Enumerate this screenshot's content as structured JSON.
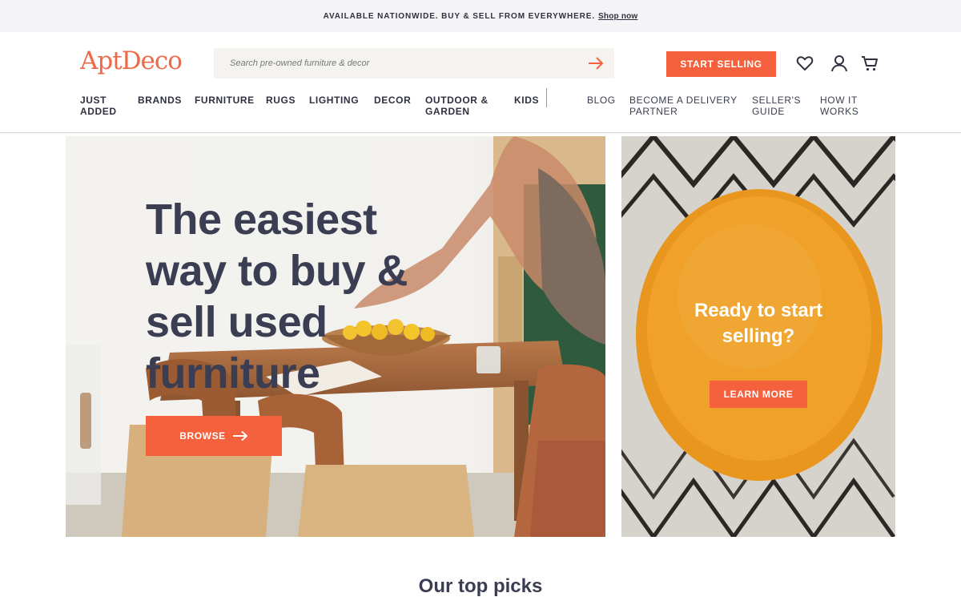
{
  "announcement": {
    "text": "AVAILABLE NATIONWIDE. BUY & SELL FROM EVERYWHERE.",
    "link": "Shop now"
  },
  "header": {
    "logo": "AptDeco",
    "search": {
      "placeholder": "Search pre-owned furniture & decor",
      "value": ""
    },
    "start_selling": "START SELLING",
    "icons": [
      "heart-icon",
      "user-icon",
      "cart-icon"
    ]
  },
  "nav": {
    "primary": [
      {
        "label": "JUST\nADDED"
      },
      {
        "label": "BRANDS"
      },
      {
        "label": "FURNITURE"
      },
      {
        "label": "RUGS"
      },
      {
        "label": "LIGHTING"
      },
      {
        "label": "DECOR"
      },
      {
        "label": "OUTDOOR &\nGARDEN"
      },
      {
        "label": "KIDS"
      }
    ],
    "secondary": [
      {
        "label": "BLOG"
      },
      {
        "label": "BECOME A DELIVERY\nPARTNER"
      },
      {
        "label": "SELLER'S\nGUIDE"
      },
      {
        "label": "HOW IT\nWORKS"
      }
    ]
  },
  "hero": {
    "title": "The easiest way to buy & sell used furniture",
    "browse": "BROWSE"
  },
  "promo": {
    "title": "Ready to start selling?",
    "button": "LEARN MORE"
  },
  "section": {
    "title": "Our top picks"
  },
  "colors": {
    "accent": "#f5603d",
    "text": "#3b3e52",
    "announce_bg": "#f4f4f6"
  }
}
